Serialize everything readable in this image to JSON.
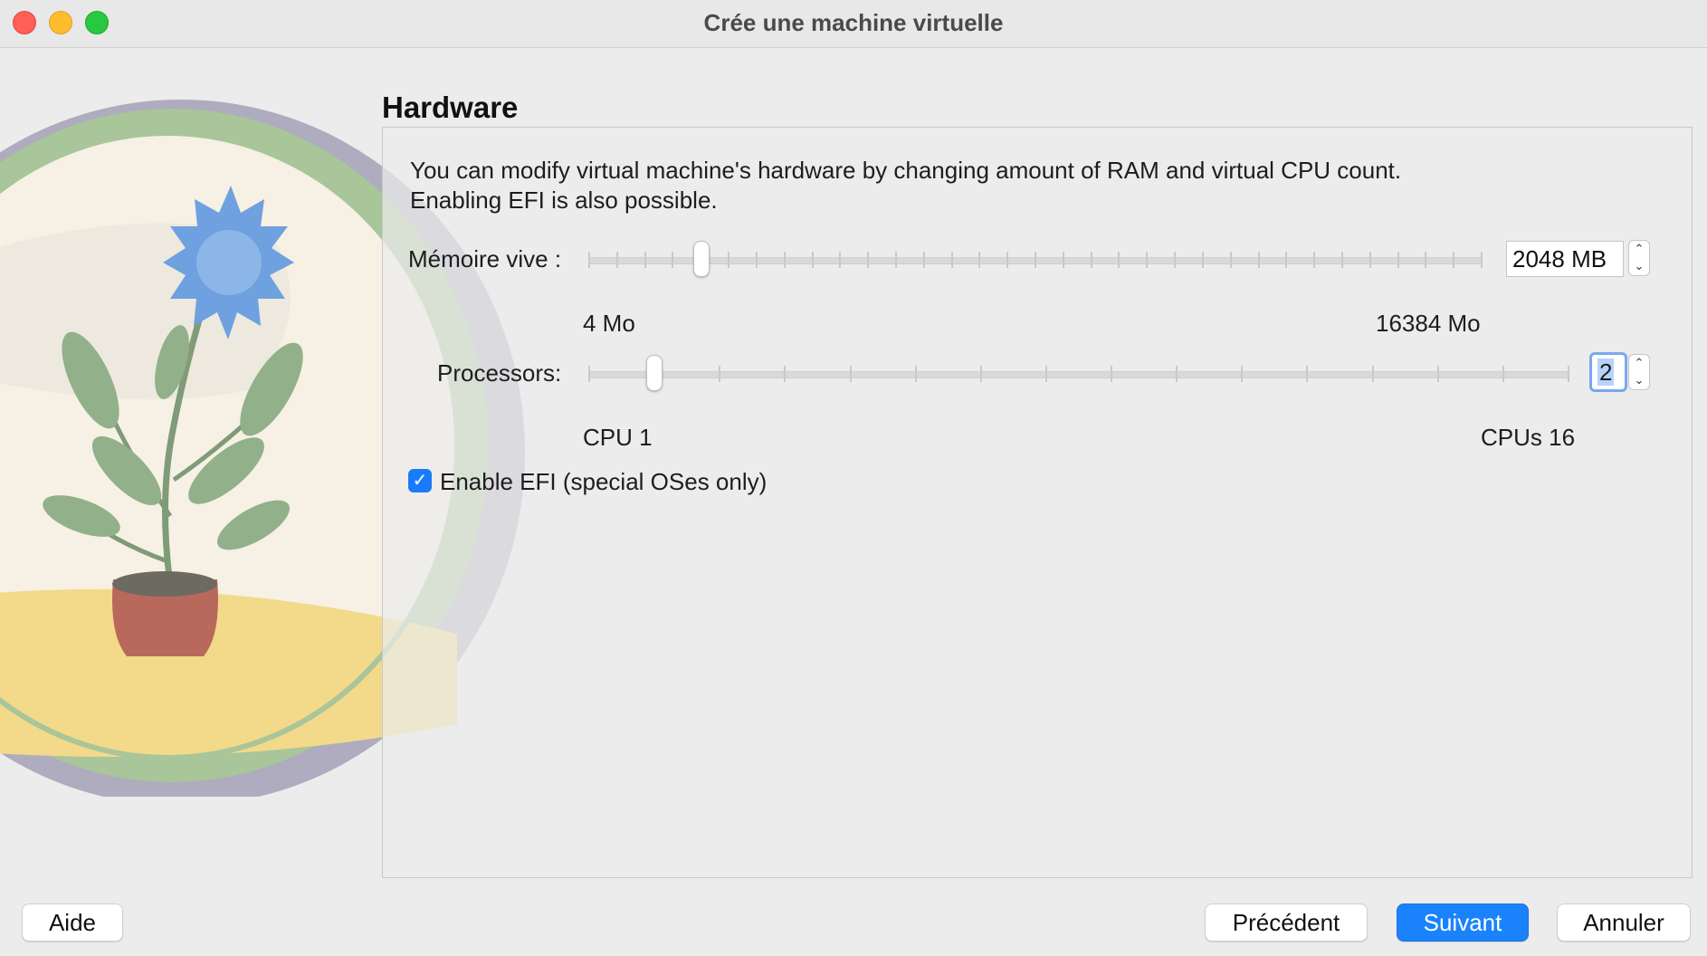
{
  "window": {
    "title": "Crée une machine virtuelle",
    "controls": [
      "close-icon",
      "minimize-icon",
      "zoom-icon"
    ]
  },
  "section": {
    "title": "Hardware",
    "description_line1": "You can modify virtual machine's hardware by changing amount of RAM and virtual CPU count.",
    "description_line2": "Enabling EFI is also possible."
  },
  "memory": {
    "label": "Mémoire vive :",
    "value": "2048 MB",
    "min_label": "4 Mo",
    "max_label": "16384 Mo",
    "slider_fraction": 0.125
  },
  "processors": {
    "label": "Processors:",
    "value": "2",
    "min_label": "CPU 1",
    "max_label": "CPUs 16",
    "slider_fraction": 0.0667
  },
  "efi": {
    "label": "Enable EFI (special OSes only)",
    "checked": true
  },
  "buttons": {
    "help": "Aide",
    "previous": "Précédent",
    "next": "Suivant",
    "cancel": "Annuler"
  },
  "colors": {
    "accent": "#1a82fb",
    "close": "#fe5f57",
    "minimize": "#febc2e",
    "zoom": "#28c840"
  }
}
